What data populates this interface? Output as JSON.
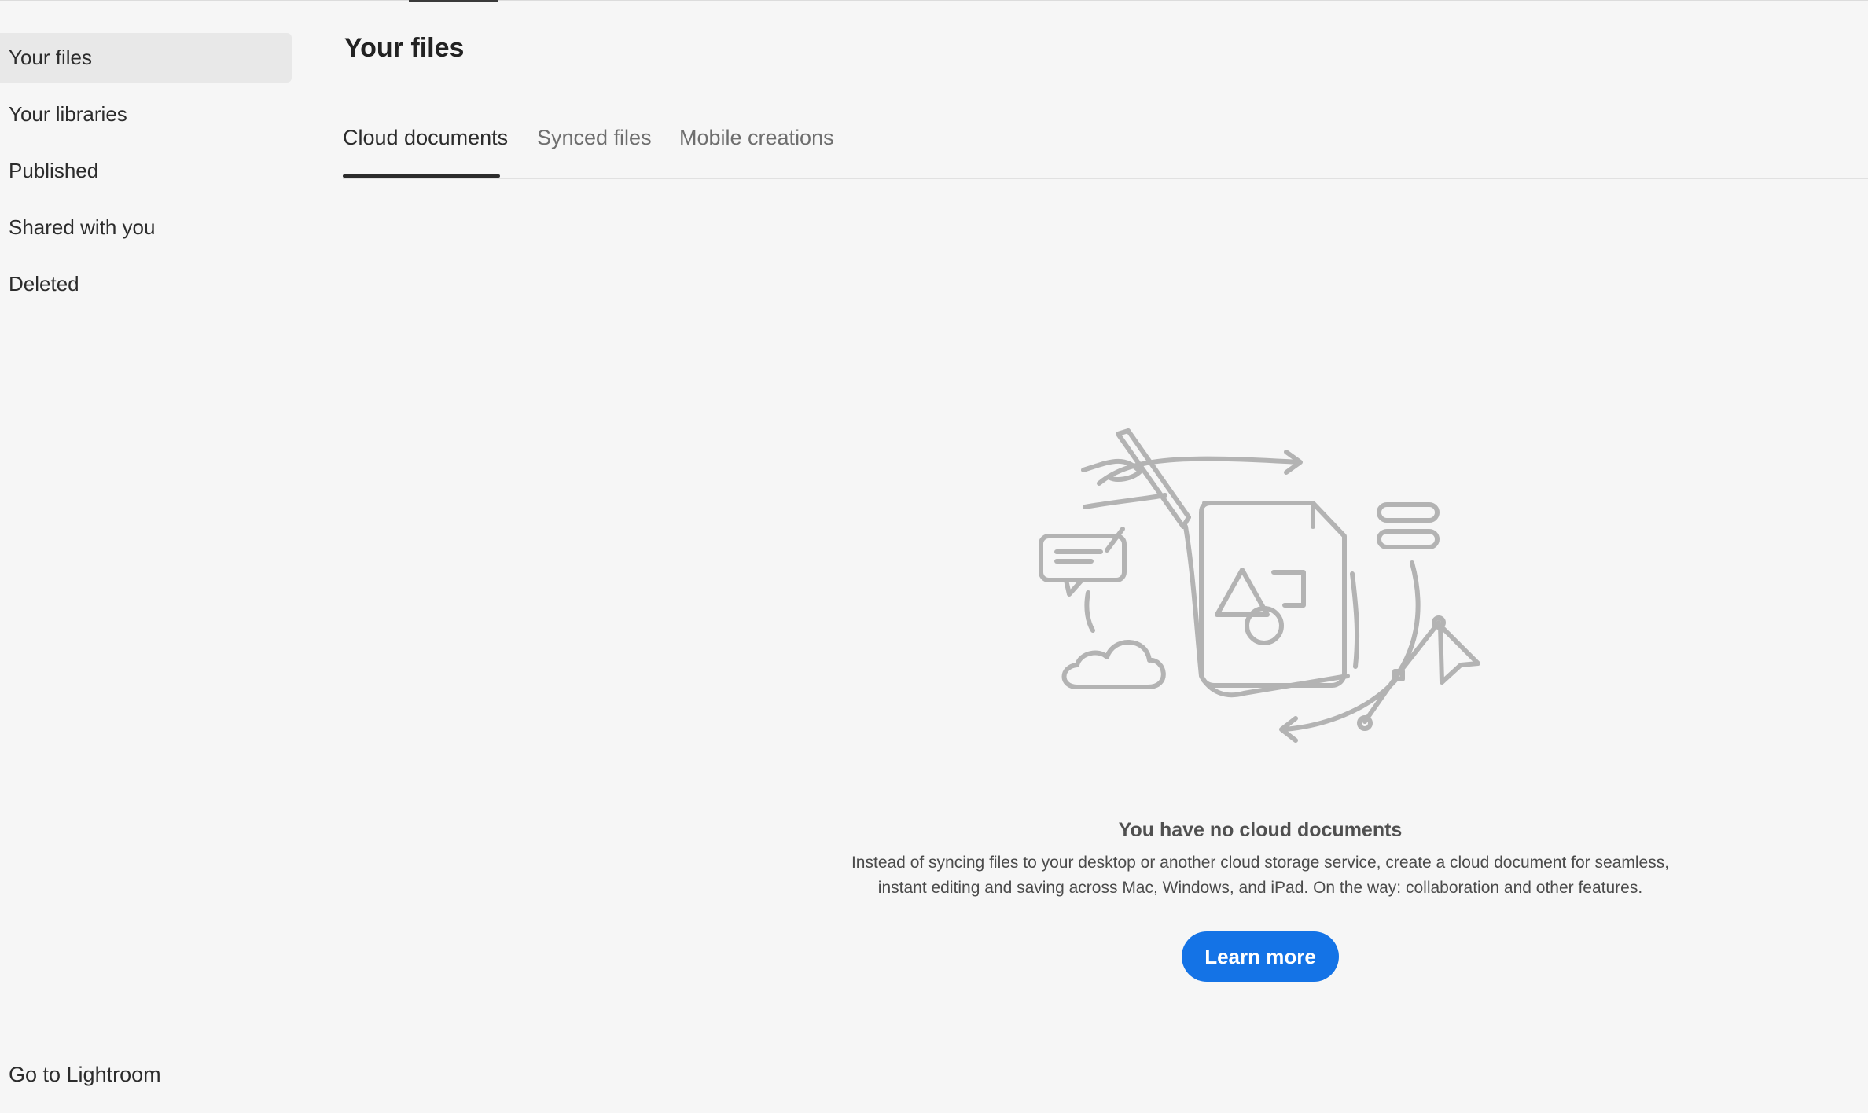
{
  "sidebar": {
    "items": [
      {
        "label": "Your files",
        "active": true
      },
      {
        "label": "Your libraries",
        "active": false
      },
      {
        "label": "Published",
        "active": false
      },
      {
        "label": "Shared with you",
        "active": false
      },
      {
        "label": "Deleted",
        "active": false
      }
    ],
    "bottom_link": "Go to Lightroom"
  },
  "main": {
    "title": "Your files",
    "tabs": [
      {
        "label": "Cloud documents",
        "active": true
      },
      {
        "label": "Synced files",
        "active": false
      },
      {
        "label": "Mobile creations",
        "active": false
      }
    ],
    "empty_state": {
      "illustration_icon": "cloud-documents-illustration-icon",
      "title": "You have no cloud documents",
      "description_line1": "Instead of syncing files to your desktop or another cloud storage service, create a cloud document for seamless,",
      "description_line2": "instant editing and saving across Mac, Windows, and iPad. On the way: collaboration and other features.",
      "button_label": "Learn more"
    }
  },
  "colors": {
    "background": "#f6f6f6",
    "sidebar_active": "#e8e8e8",
    "accent": "#1473e6",
    "illustration_stroke": "#b3b3b3"
  }
}
